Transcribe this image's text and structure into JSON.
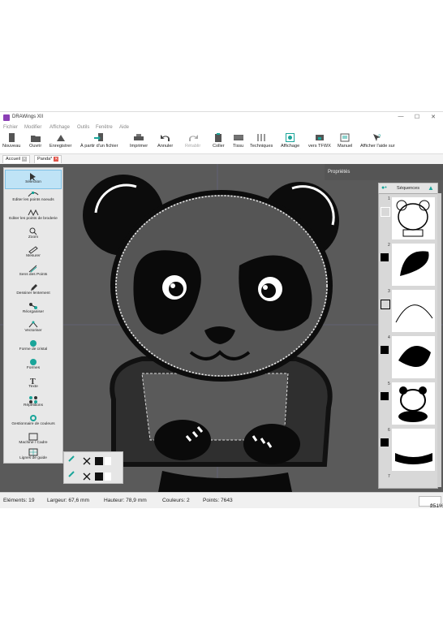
{
  "window": {
    "title": "DRAWings XII",
    "controls": [
      "—",
      "☐",
      "✕"
    ]
  },
  "menu": [
    "Fichier",
    "Modifier",
    "Affichage",
    "Outils",
    "Fenêtre",
    "Aide"
  ],
  "toolbar": [
    {
      "label": "Nouveau",
      "icon": "new-file-icon"
    },
    {
      "label": "Ouvrir",
      "icon": "open-folder-icon"
    },
    {
      "label": "Enregistrer",
      "icon": "save-icon"
    },
    {
      "label": "À partir d'un fichier",
      "icon": "import-file-icon"
    },
    {
      "label": "Imprimer",
      "icon": "print-icon"
    },
    {
      "label": "Annuler",
      "icon": "undo-icon"
    },
    {
      "label": "Rétablir",
      "icon": "redo-icon",
      "disabled": true
    },
    {
      "label": "Coller",
      "icon": "paste-icon"
    },
    {
      "label": "Tissu",
      "icon": "fabric-icon"
    },
    {
      "label": "Techniques",
      "icon": "techniques-icon"
    },
    {
      "label": "Affichage",
      "icon": "view-icon"
    },
    {
      "label": "vers TFWX",
      "icon": "tfwx-icon"
    },
    {
      "label": "Manuel",
      "icon": "manual-icon"
    },
    {
      "label": "Afficher l'aide sur",
      "icon": "help-pointer-icon"
    }
  ],
  "tabs": [
    {
      "label": "Accueil",
      "active": false
    },
    {
      "label": "Panda*",
      "active": true
    }
  ],
  "tools": [
    {
      "label": "Sélection",
      "icon": "selection-arrow-icon",
      "selected": true
    },
    {
      "label": "Editer les points noeuds",
      "icon": "edit-nodes-icon"
    },
    {
      "label": "Editer les points de broderie",
      "icon": "edit-stitches-icon"
    },
    {
      "label": "Zoom",
      "icon": "zoom-icon"
    },
    {
      "label": "Mesurer",
      "icon": "ruler-icon"
    },
    {
      "label": "Sens des Points",
      "icon": "stitch-direction-icon"
    },
    {
      "label": "Dessiner lentement",
      "icon": "draw-slow-icon"
    },
    {
      "label": "Réorganiser",
      "icon": "reorganize-icon"
    },
    {
      "label": "Vectoriser",
      "icon": "vectorize-icon"
    },
    {
      "label": "Forme de cristal",
      "icon": "crystal-shape-icon"
    },
    {
      "label": "Formes",
      "icon": "shapes-icon"
    },
    {
      "label": "Texte",
      "icon": "text-icon"
    },
    {
      "label": "Répétitions",
      "icon": "repetitions-icon"
    },
    {
      "label": "Gestionnaire de couleurs",
      "icon": "color-manager-icon"
    },
    {
      "label": "Machine / Cadre",
      "icon": "machine-frame-icon"
    },
    {
      "label": "Lignes de guide",
      "icon": "guide-lines-icon"
    }
  ],
  "properties": {
    "title": "Propriétés"
  },
  "sequences": {
    "header": "Séquences",
    "items": [
      {
        "num": "1",
        "swatch": "none",
        "thumb": "panda-outline"
      },
      {
        "num": "2",
        "swatch": "#000000",
        "thumb": "ear-fill"
      },
      {
        "num": "3",
        "swatch": "none",
        "thumb": "arc-line"
      },
      {
        "num": "4",
        "swatch": "#000000",
        "thumb": "leaf-fill"
      },
      {
        "num": "5",
        "swatch": "#000000",
        "thumb": "panda-small"
      },
      {
        "num": "6",
        "swatch": "#000000",
        "thumb": "paws-fill"
      },
      {
        "num": "7",
        "swatch": "none",
        "thumb": "partial"
      }
    ]
  },
  "status": {
    "elements": "Eléments: 19",
    "width": "Largeur: 67,6 mm",
    "height": "Hauteur: 78,9 mm",
    "colors": "Couleurs: 2",
    "points": "Points: 7643",
    "zoom": "251%"
  },
  "colors": {
    "canvas_bg": "#5a5a5a",
    "selected_tool": "#bfe3f6",
    "accent_teal": "#1aa59a",
    "tab_close": "#e0554a"
  }
}
